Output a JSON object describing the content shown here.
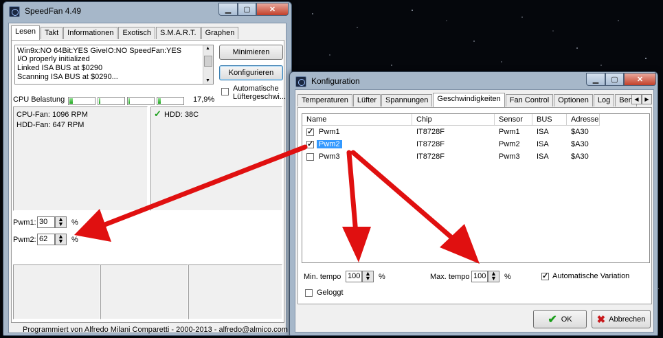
{
  "colors": {
    "accent_red": "#e01010",
    "selection": "#3399ff",
    "progress": "#1fa61f"
  },
  "main": {
    "title": "SpeedFan 4.49",
    "tabs": [
      {
        "label": "Lesen"
      },
      {
        "label": "Takt"
      },
      {
        "label": "Informationen"
      },
      {
        "label": "Exotisch"
      },
      {
        "label": "S.M.A.R.T."
      },
      {
        "label": "Graphen"
      }
    ],
    "log": [
      "Win9x:NO  64Bit:YES  GiveIO:NO  SpeedFan:YES",
      "I/O properly initialized",
      "Linked ISA BUS at $0290",
      "Scanning ISA BUS at $0290..."
    ],
    "minimize_label": "Minimieren",
    "configure_label": "Konfigurieren",
    "auto_fan_label": "Automatische Lüftergeschwi...",
    "cpu_usage_label": "CPU Belastung",
    "cpu_usage_value": "17,9%",
    "cpu_bars": [
      0.12,
      0.04,
      0.02,
      0.1
    ],
    "fans": [
      "CPU-Fan: 1096 RPM",
      "HDD-Fan: 647 RPM"
    ],
    "temps": [
      "HDD: 38C"
    ],
    "pwm": [
      {
        "label": "Pwm1:",
        "value": "30",
        "unit": "%"
      },
      {
        "label": "Pwm2:",
        "value": "62",
        "unit": "%"
      }
    ],
    "footer": "Programmiert von Alfredo Milani Comparetti - 2000-2013 - alfredo@almico.com"
  },
  "config": {
    "title": "Konfiguration",
    "tabs": [
      {
        "label": "Temperaturen"
      },
      {
        "label": "Lüfter"
      },
      {
        "label": "Spannungen"
      },
      {
        "label": "Geschwindigkeiten"
      },
      {
        "label": "Fan Control"
      },
      {
        "label": "Optionen"
      },
      {
        "label": "Log"
      },
      {
        "label": "Benut"
      }
    ],
    "columns": [
      "Name",
      "Chip",
      "Sensor",
      "BUS",
      "Adresse"
    ],
    "rows": [
      {
        "name": "Pwm1",
        "chip": "IT8728F",
        "sensor": "Pwm1",
        "bus": "ISA",
        "address": "$A30",
        "checked": true
      },
      {
        "name": "Pwm2",
        "chip": "IT8728F",
        "sensor": "Pwm2",
        "bus": "ISA",
        "address": "$A30",
        "checked": true
      },
      {
        "name": "Pwm3",
        "chip": "IT8728F",
        "sensor": "Pwm3",
        "bus": "ISA",
        "address": "$A30",
        "checked": false
      }
    ],
    "min_tempo_label": "Min. tempo",
    "min_tempo_value": "100",
    "max_tempo_label": "Max. tempo",
    "max_tempo_value": "100",
    "percent_unit": "%",
    "auto_variation_label": "Automatische Variation",
    "logged_label": "Geloggt",
    "ok_label": "OK",
    "cancel_label": "Abbrechen"
  }
}
